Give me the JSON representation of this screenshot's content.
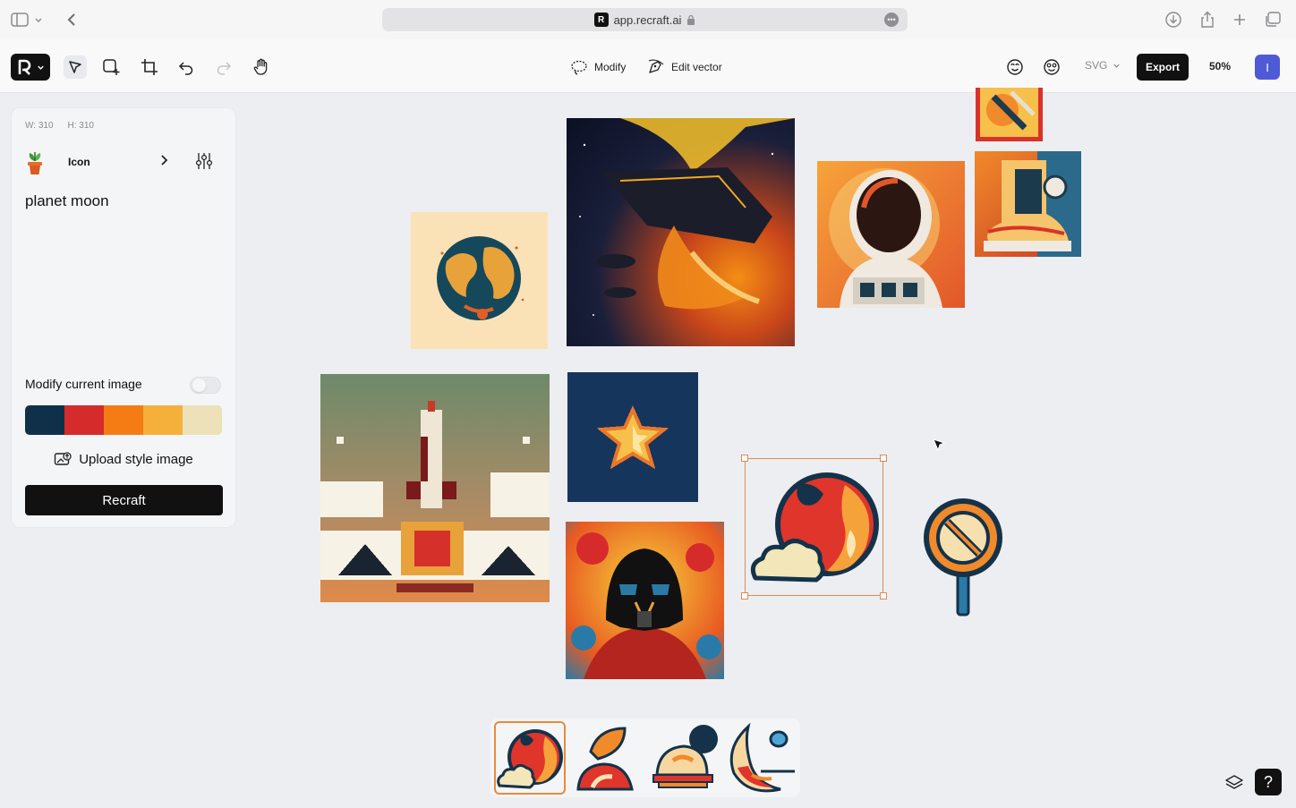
{
  "browser": {
    "url": "app.recraft.ai",
    "favicon_text": "R"
  },
  "toolbar": {
    "modify_label": "Modify",
    "edit_vector_label": "Edit vector",
    "format_value": "SVG",
    "export_label": "Export",
    "zoom_value": "50%",
    "avatar_initial": "I"
  },
  "panel": {
    "width_label": "W: 310",
    "height_label": "H: 310",
    "style_name": "Icon",
    "prompt": "planet moon",
    "modify_label": "Modify current image",
    "palette": [
      "#10304a",
      "#d62b2b",
      "#f57c14",
      "#f5b03c",
      "#ece1b8"
    ],
    "upload_label": "Upload style image",
    "recraft_label": "Recraft"
  },
  "help_label": "?",
  "colors": {
    "accent": "#e08a52",
    "dark": "#111111",
    "avatar": "#4e5ad6"
  }
}
